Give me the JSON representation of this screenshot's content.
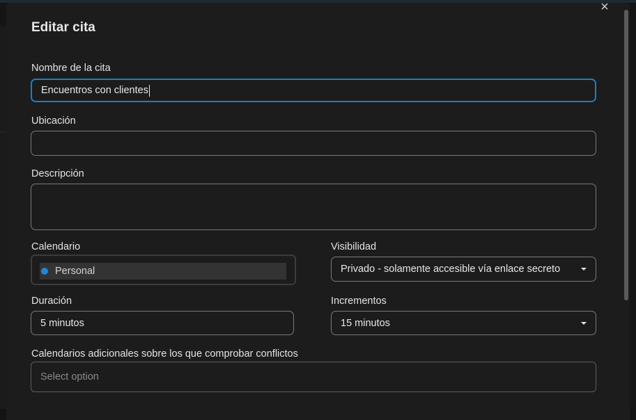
{
  "dialog": {
    "title": "Editar cita",
    "close_icon": "×"
  },
  "fields": {
    "name": {
      "label": "Nombre de la cita",
      "value": "Encuentros con clientes"
    },
    "location": {
      "label": "Ubicación",
      "value": ""
    },
    "description": {
      "label": "Descripción",
      "value": ""
    },
    "calendar": {
      "label": "Calendario",
      "selected": "Personal",
      "dot_color": "#1e88d8"
    },
    "visibility": {
      "label": "Visibilidad",
      "selected": "Privado - solamente accesible vía enlace secreto"
    },
    "duration": {
      "label": "Duración",
      "value": "5 minutos"
    },
    "increments": {
      "label": "Incrementos",
      "selected": "15 minutos"
    },
    "conflicts": {
      "label": "Calendarios adicionales sobre los que comprobar conflictos",
      "placeholder": "Select option"
    }
  },
  "colors": {
    "accent": "#1b7fc4",
    "background": "#1c1c1c"
  }
}
